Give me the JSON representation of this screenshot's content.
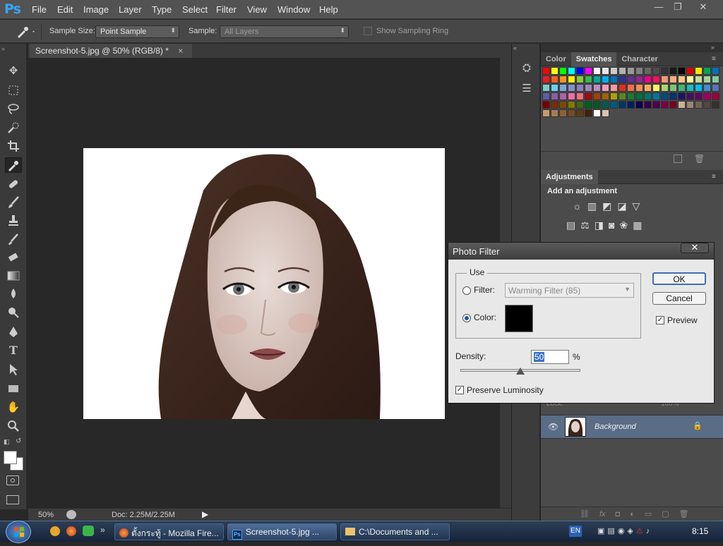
{
  "app": {
    "logo": "Ps",
    "menu": [
      "File",
      "Edit",
      "Image",
      "Layer",
      "Type",
      "Select",
      "Filter",
      "View",
      "Window",
      "Help"
    ],
    "window_controls": [
      "—",
      "❐",
      "✕"
    ]
  },
  "options_bar": {
    "tool_icon": "eyedropper-icon",
    "sample_size_label": "Sample Size:",
    "sample_size_value": "Point Sample",
    "sample_label": "Sample:",
    "sample_value": "All Layers",
    "show_sampling_ring_label": "Show Sampling Ring",
    "show_sampling_ring_checked": false
  },
  "toolbar": {
    "tools": [
      "move-icon",
      "marquee-icon",
      "lasso-icon",
      "quick-select-icon",
      "crop-icon",
      "eyedropper-icon",
      "healing-brush-icon",
      "brush-icon",
      "clone-stamp-icon",
      "history-brush-icon",
      "eraser-icon",
      "gradient-icon",
      "blur-icon",
      "dodge-icon",
      "pen-icon",
      "type-icon",
      "path-select-icon",
      "shape-icon",
      "hand-icon",
      "zoom-icon"
    ],
    "active_tool": "eyedropper-icon",
    "type_glyph": "T"
  },
  "document": {
    "tab_title": "Screenshot-5.jpg @ 50% (RGB/8) *",
    "tab_close": "×",
    "zoom": "50%",
    "doc_info": "Doc: 2.25M/2.25M"
  },
  "panels": {
    "swatch_tabs": [
      "Color",
      "Swatches",
      "Character"
    ],
    "active_swatch_tab": "Swatches",
    "swatch_colors": [
      "#ff0000",
      "#ffff00",
      "#00ff00",
      "#00ffff",
      "#0000ff",
      "#ff00ff",
      "#ffffff",
      "#e6e6e6",
      "#cccccc",
      "#b3b3b3",
      "#999999",
      "#808080",
      "#666666",
      "#4d4d4d",
      "#333333",
      "#1a1a1a",
      "#000000",
      "#e00000",
      "#ffe600",
      "#00a651",
      "#0072bc",
      "#ed1c24",
      "#f26522",
      "#f7941d",
      "#fff200",
      "#8dc63f",
      "#39b54a",
      "#00a99d",
      "#00aeef",
      "#0072bc",
      "#2e3192",
      "#662d91",
      "#92278f",
      "#ec008c",
      "#ed145b",
      "#f69679",
      "#f9ad81",
      "#fdc689",
      "#fff799",
      "#c4df9b",
      "#a3d39c",
      "#82ca9c",
      "#7accc8",
      "#6dcff6",
      "#7da7d9",
      "#8393ca",
      "#8781bd",
      "#a186be",
      "#bd8cbf",
      "#f49ac2",
      "#f5989d",
      "#e0301e",
      "#f26c4f",
      "#f68e56",
      "#fbaf5d",
      "#fff568",
      "#acd373",
      "#7cc576",
      "#3cb878",
      "#1cbbb4",
      "#00bff3",
      "#448ccb",
      "#5674b9",
      "#605ca8",
      "#8560a8",
      "#a864a8",
      "#f06eaa",
      "#f26d7d",
      "#9e0b0f",
      "#a0410d",
      "#a36209",
      "#aba000",
      "#598527",
      "#1a7b30",
      "#007236",
      "#00746b",
      "#0076a3",
      "#004b80",
      "#003471",
      "#1b1464",
      "#440e62",
      "#630460",
      "#9e005d",
      "#9e0039",
      "#790000",
      "#7b2e00",
      "#7d4900",
      "#827b00",
      "#406618",
      "#005e20",
      "#005826",
      "#005952",
      "#005b7f",
      "#003663",
      "#002157",
      "#0d004c",
      "#32004b",
      "#4b0049",
      "#7b0046",
      "#7a0026",
      "#c7b299",
      "#998675",
      "#736357",
      "#534741",
      "#37302d",
      "#c69c6d",
      "#a67c52",
      "#8c6239",
      "#754c24",
      "#603913",
      "#42210b",
      "#ffffff",
      "#d9c4a9"
    ],
    "adjustments_title": "Adjustments",
    "adjustments_subtitle": "Add an adjustment",
    "adjustment_icons": [
      "brightness-icon",
      "levels-icon",
      "curves-icon",
      "exposure-icon",
      "vibrance-icon",
      "hue-saturation-icon",
      "color-balance-icon",
      "black-white-icon",
      "photo-filter-icon",
      "channel-mixer-icon",
      "color-lookup-icon"
    ],
    "layers": {
      "lock_label": "Lock:",
      "fill_value": "100%",
      "background_layer_name": "Background"
    }
  },
  "dialog": {
    "title": "Photo Filter",
    "close": "✕",
    "group_label": "Use",
    "filter_label": "Filter:",
    "filter_value": "Warming Filter (85)",
    "filter_selected": false,
    "color_label": "Color:",
    "color_selected": true,
    "color_value": "#000000",
    "density_label": "Density:",
    "density_value": "50",
    "density_unit": "%",
    "density_slider_percent": 50,
    "preserve_luminosity_label": "Preserve Luminosity",
    "preserve_luminosity_checked": true,
    "ok_label": "OK",
    "cancel_label": "Cancel",
    "preview_label": "Preview",
    "preview_checked": true
  },
  "taskbar": {
    "tasks": [
      {
        "label": "ตั้งกระทู้ - Mozilla Fire...",
        "icon": "firefox-icon"
      },
      {
        "label": "Screenshot-5.jpg ...",
        "icon": "photoshop-icon"
      },
      {
        "label": "C:\\Documents and ...",
        "icon": "folder-icon"
      }
    ],
    "language": "EN",
    "clock": "8:15"
  }
}
